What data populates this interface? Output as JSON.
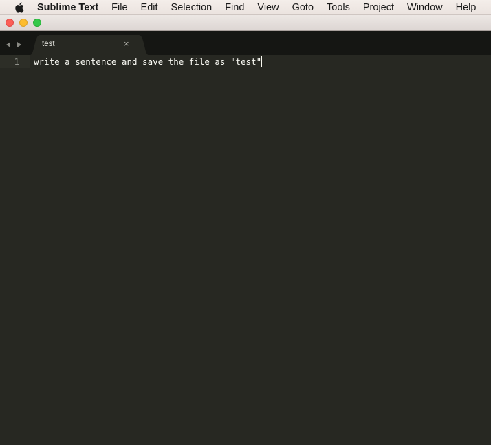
{
  "menubar": {
    "apple_icon": "apple-logo",
    "app_name": "Sublime Text",
    "items": [
      "File",
      "Edit",
      "Selection",
      "Find",
      "View",
      "Goto",
      "Tools",
      "Project",
      "Window",
      "Help"
    ]
  },
  "window": {
    "controls": [
      "close",
      "minimize",
      "zoom"
    ]
  },
  "tabs": {
    "nav_back_icon": "triangle-left",
    "nav_forward_icon": "triangle-right",
    "items": [
      {
        "label": "test",
        "close_symbol": "×",
        "active": true
      }
    ]
  },
  "editor": {
    "lines": [
      {
        "number": "1",
        "text": "write a sentence and save the file as \"test\""
      }
    ]
  },
  "colors": {
    "editor_bg": "#272822",
    "tabstrip_bg": "#151613",
    "text": "#f8f8f2",
    "gutter_text": "#8f908a"
  }
}
